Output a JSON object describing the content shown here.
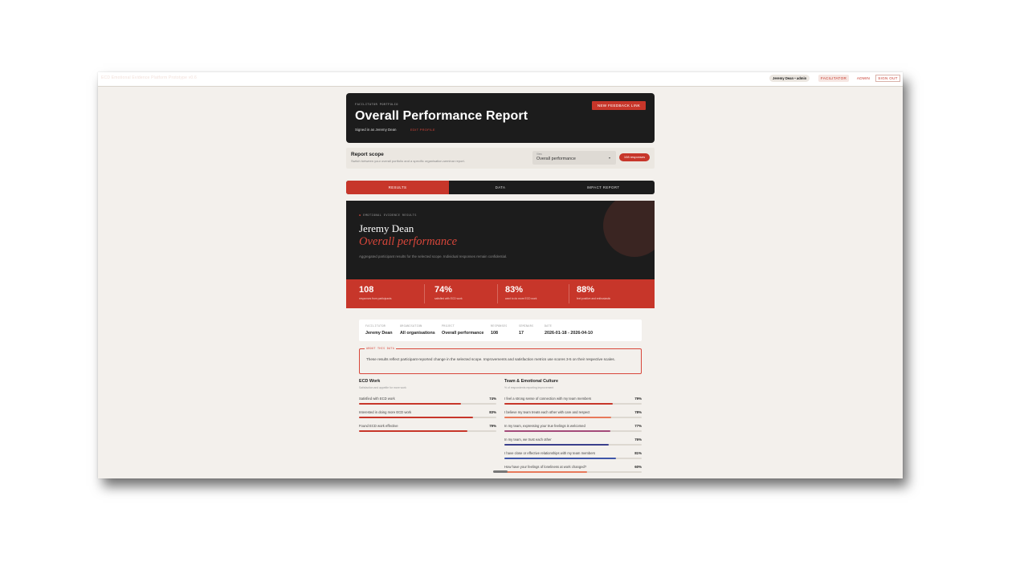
{
  "topbar": {
    "app_title": "ECD Emotional Evidence Platform Prototype v0.6",
    "user": "Jeremy Dean • admin",
    "facilitator_btn": "FACILITATOR",
    "admin_btn": "ADMIN",
    "signout_btn": "SIGN OUT"
  },
  "hero": {
    "eyebrow": "FACILITATOR PORTFOLIO",
    "title": "Overall Performance Report",
    "signed_in": "Signed in as Jeremy Dean",
    "edit_profile": "EDIT PROFILE",
    "new_link": "NEW FEEDBACK LINK"
  },
  "scope": {
    "title": "Report scope",
    "subtitle": "Switch between your overall portfolio and a specific organisation-seminar report.",
    "view_label": "View",
    "view_value": "Overall performance",
    "responses_pill": "108 responses"
  },
  "tabs": [
    {
      "label": "RESULTS",
      "active": true
    },
    {
      "label": "DATA",
      "active": false
    },
    {
      "label": "IMPACT REPORT",
      "active": false
    }
  ],
  "results": {
    "eyebrow": "EMOTIONAL EVIDENCE RESULTS",
    "name": "Jeremy Dean",
    "scope_title": "Overall performance",
    "description": "Aggregated participant results for the selected scope. Individual responses remain confidential."
  },
  "stats": [
    {
      "value": "108",
      "label": "responses from participants"
    },
    {
      "value": "74%",
      "label": "satisfied with ECD work"
    },
    {
      "value": "83%",
      "label": "want to do more ECD work"
    },
    {
      "value": "88%",
      "label": "feel positive and enthusiastic"
    }
  ],
  "meta": [
    {
      "key": "FACILITATOR",
      "value": "Jeremy Dean"
    },
    {
      "key": "ORGANISATION",
      "value": "All organisations"
    },
    {
      "key": "PROJECT",
      "value": "Overall performance"
    },
    {
      "key": "RESPONSES",
      "value": "108"
    },
    {
      "key": "SEMINARS",
      "value": "17"
    },
    {
      "key": "DATE",
      "value": "2026-01-18 - 2026-04-10"
    }
  ],
  "about": {
    "label": "ABOUT THIS DATA",
    "text": "These results reflect participant-reported change in the selected scope. Improvements and satisfaction metrics use scores 3-5 on their respective scales."
  },
  "ecd": {
    "title": "ECD Work",
    "subtitle": "Satisfaction and appetite for more work",
    "items": [
      {
        "label": "Satisfied with ECD work",
        "value": "74%",
        "pct": 74,
        "color": "#c7362a"
      },
      {
        "label": "Interested in doing more ECD work",
        "value": "83%",
        "pct": 83,
        "color": "#c7362a"
      },
      {
        "label": "Found ECD work effective",
        "value": "79%",
        "pct": 79,
        "color": "#c7362a"
      }
    ]
  },
  "team": {
    "title": "Team & Emotional Culture",
    "subtitle": "% of respondents reporting improvement",
    "items": [
      {
        "label": "I feel a strong sense of connection with my team members",
        "value": "79%",
        "pct": 79,
        "color": "#c7362a"
      },
      {
        "label": "I believe my team treats each other with care and respect",
        "value": "78%",
        "pct": 78,
        "color": "#e8795a"
      },
      {
        "label": "In my team, expressing your true feelings is welcomed",
        "value": "77%",
        "pct": 77,
        "color": "#a44a7a"
      },
      {
        "label": "In my team, we trust each other",
        "value": "76%",
        "pct": 76,
        "color": "#3a3f8c"
      },
      {
        "label": "I have close or effective relationships with my team members",
        "value": "81%",
        "pct": 81,
        "color": "#3e55a8"
      },
      {
        "label": "How have your feelings of loneliness at work changed?",
        "value": "60%",
        "pct": 60,
        "color": "#e8795a"
      }
    ]
  }
}
